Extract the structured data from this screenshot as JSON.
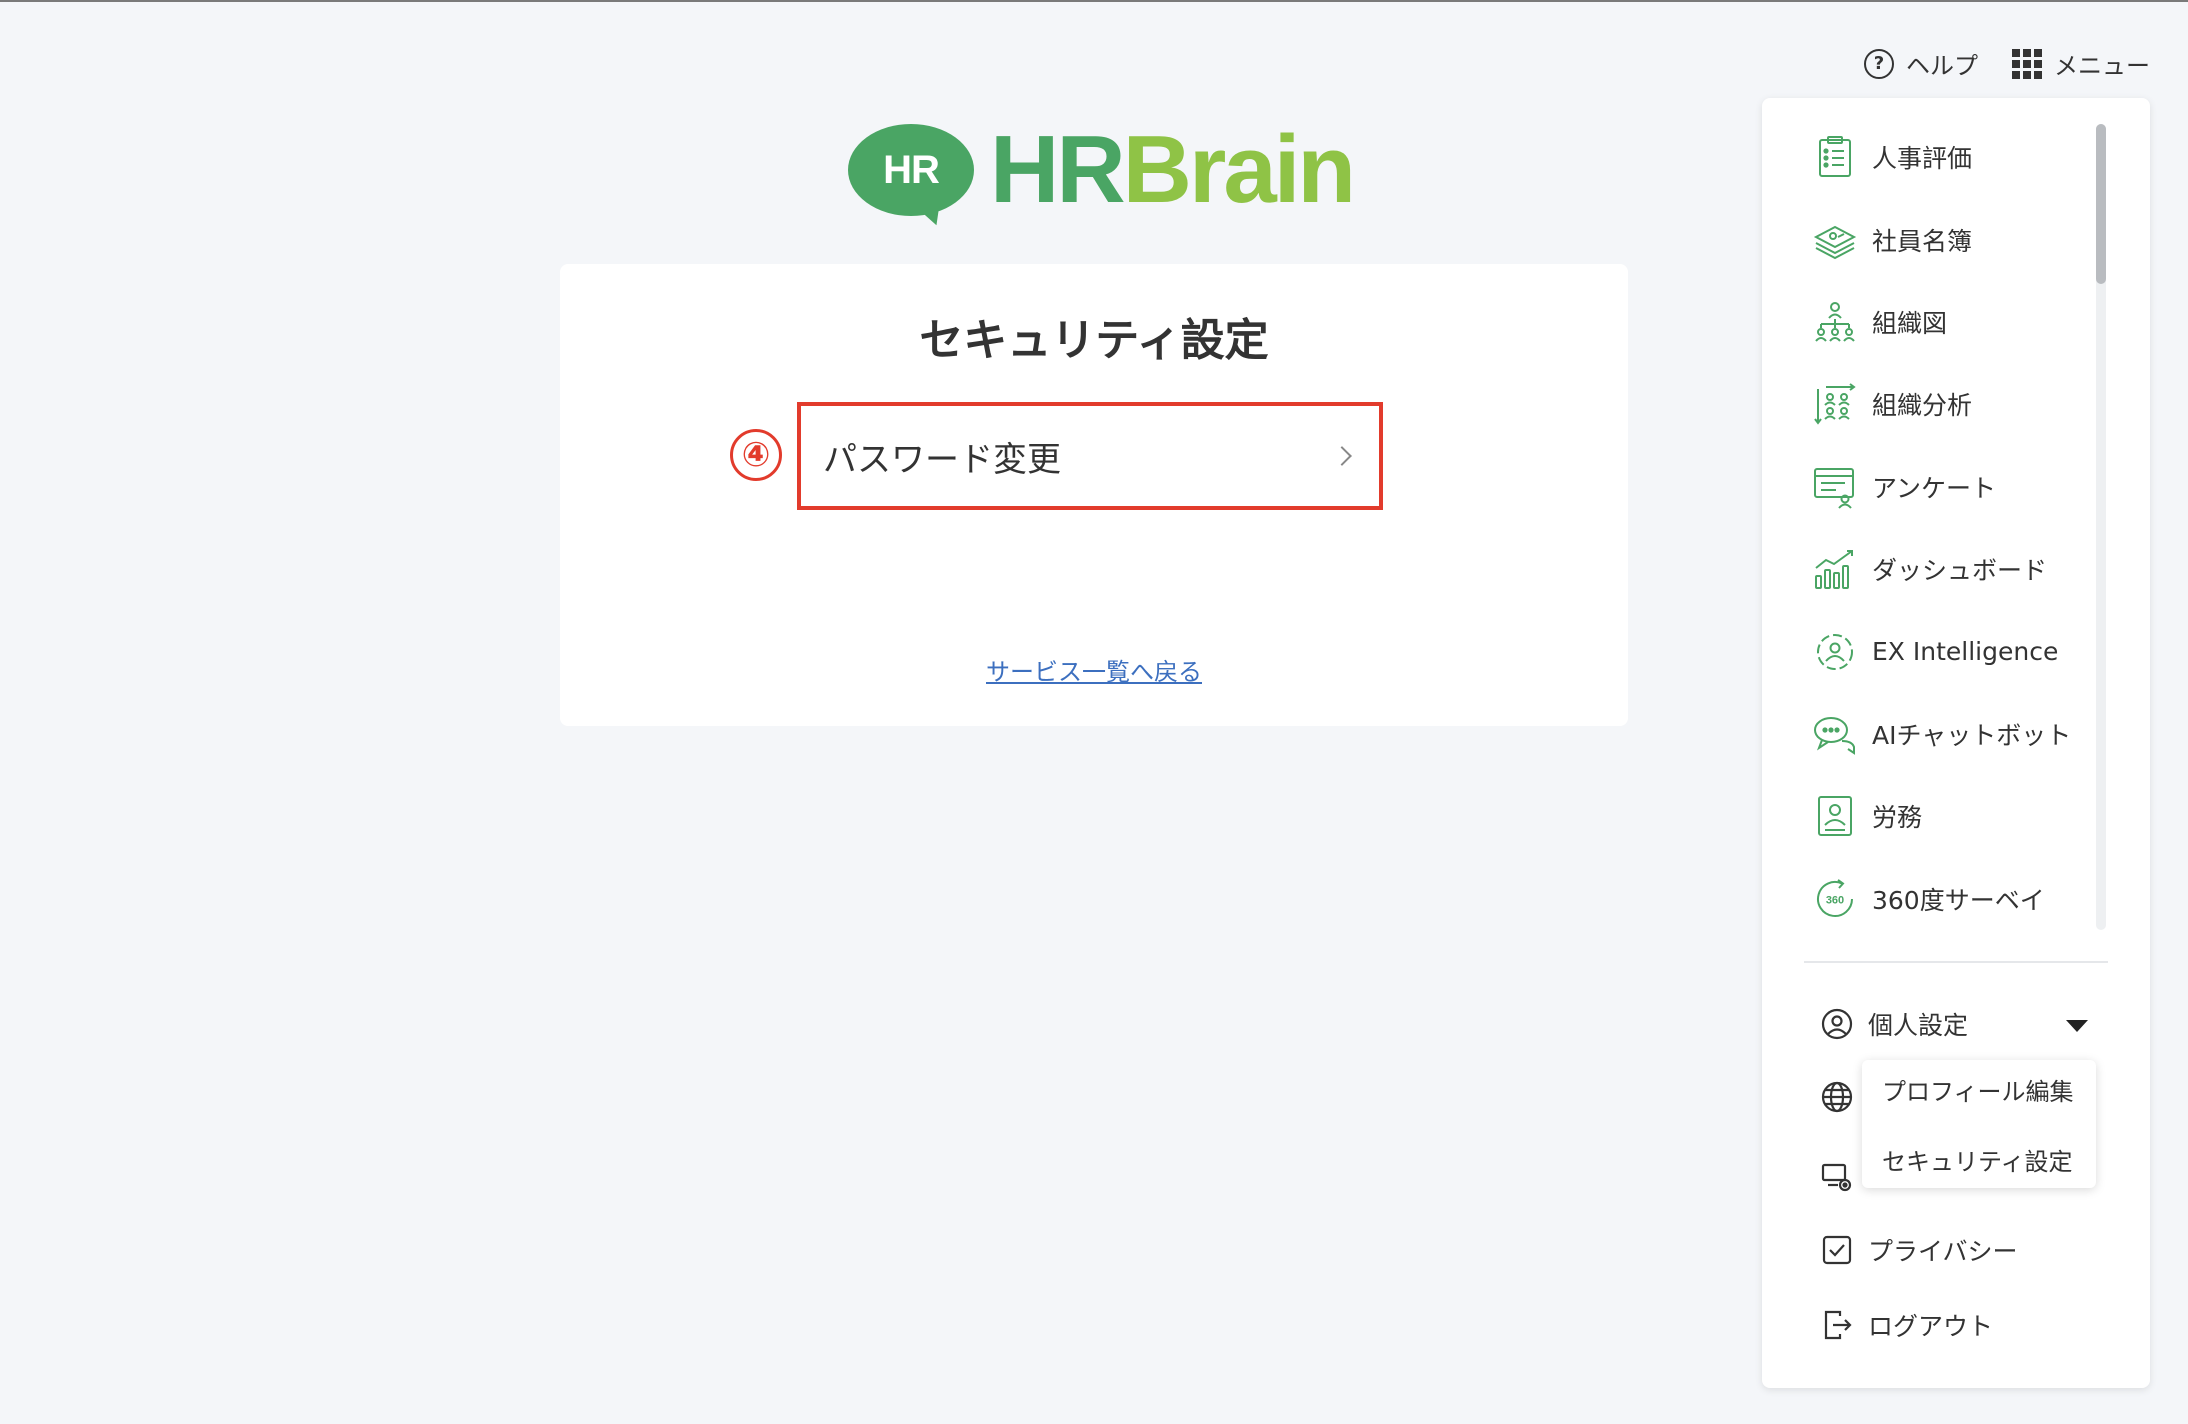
{
  "header": {
    "help_icon": "question-circle-icon",
    "help_label": "ヘルプ",
    "menu_icon": "grid-icon",
    "menu_label": "メニュー"
  },
  "logo": {
    "badge_text": "HR",
    "name_hr": "HR",
    "name_brain": "Brain",
    "colors": {
      "green": "#4aa564",
      "lime": "#8fc346"
    }
  },
  "main": {
    "title": "セキュリティ設定",
    "step_marker": "④",
    "password_change_label": "パスワード変更",
    "back_link": "サービス一覧へ戻る"
  },
  "menu": {
    "services": [
      {
        "label": "人事評価",
        "icon": "evaluation-clipboard-icon"
      },
      {
        "label": "社員名簿",
        "icon": "employee-directory-icon"
      },
      {
        "label": "組織図",
        "icon": "org-chart-icon"
      },
      {
        "label": "組織分析",
        "icon": "org-analysis-icon"
      },
      {
        "label": "アンケート",
        "icon": "survey-icon"
      },
      {
        "label": "ダッシュボード",
        "icon": "dashboard-chart-icon"
      },
      {
        "label": "EX Intelligence",
        "icon": "ex-intelligence-icon"
      },
      {
        "label": "AIチャットボット",
        "icon": "chatbot-icon"
      },
      {
        "label": "労務",
        "icon": "labor-icon"
      },
      {
        "label": "360度サーベイ",
        "icon": "survey-360-icon"
      }
    ],
    "personal_settings": "個人設定",
    "privacy": "プライバシー",
    "logout": "ログアウト",
    "submenu": {
      "profile_edit": "プロフィール編集",
      "security_settings": "セキュリティ設定"
    },
    "icon_badge_360": "360"
  },
  "colors": {
    "accent_red": "#e23b2c",
    "link_blue": "#3c6fbf",
    "icon_green": "#4aa564"
  }
}
